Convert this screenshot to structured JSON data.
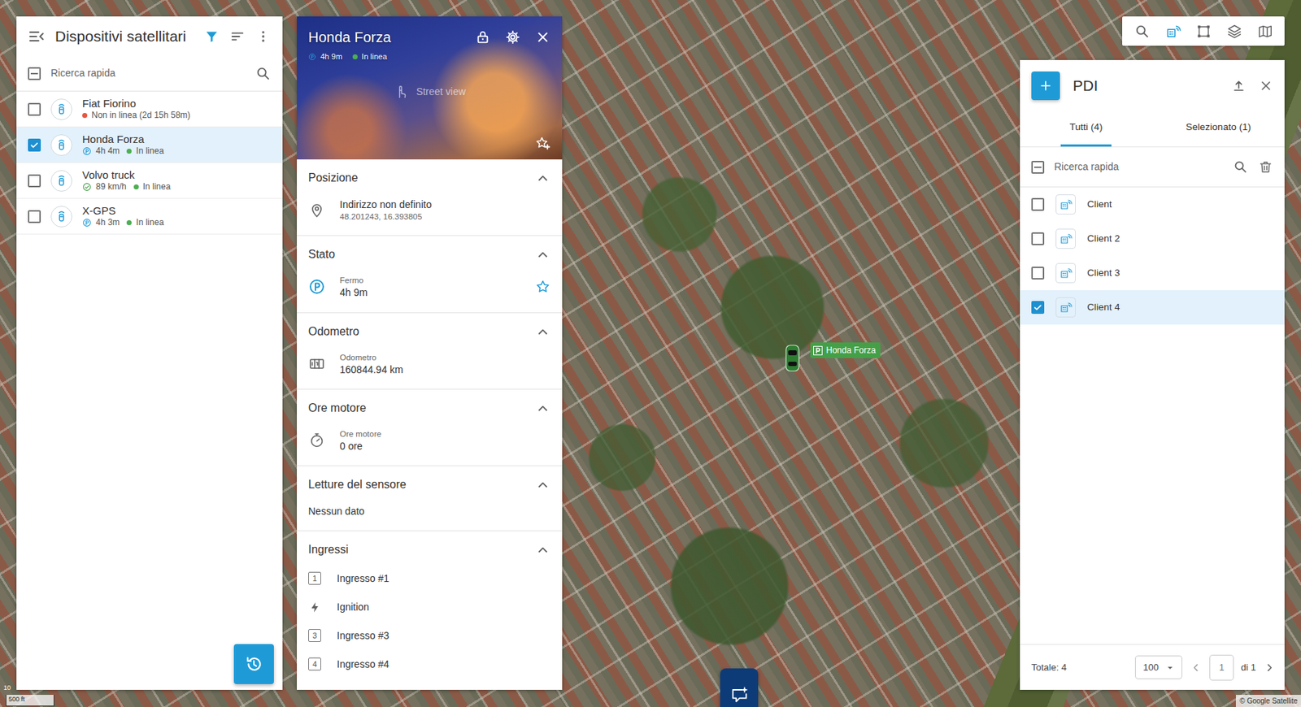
{
  "map": {
    "marker": {
      "label": "Honda Forza",
      "parked": true
    },
    "scale": {
      "metric": "10",
      "imperial": "500 ft"
    },
    "attribution": "© Google Satellite"
  },
  "toolbar": {
    "buttons": [
      {
        "selected": false
      },
      {
        "selected": true
      },
      {
        "selected": false
      },
      {
        "selected": false
      },
      {
        "selected": false
      }
    ]
  },
  "devices_panel": {
    "title": "Dispositivi satellitari",
    "search": {
      "placeholder": "Ricerca rapida"
    },
    "select_all": {
      "checked": false,
      "indeterminate": true
    },
    "items": [
      {
        "name": "Fiat Fiorino",
        "kind": "offline",
        "connection": "Non in linea (2d 15h 58m)",
        "color": "#e8553e",
        "checked": false,
        "selected": false
      },
      {
        "name": "Honda Forza",
        "kind": "parked",
        "motion": "4h 4m",
        "connection": "In linea",
        "color": "#4caf50",
        "checked": true,
        "selected": true
      },
      {
        "name": "Volvo truck",
        "kind": "moving",
        "motion": "89 km/h",
        "connection": "In linea",
        "color": "#4caf50",
        "checked": false,
        "selected": false
      },
      {
        "name": "X-GPS",
        "kind": "parked",
        "motion": "4h 3m",
        "connection": "In linea",
        "color": "#4caf50",
        "checked": false,
        "selected": false
      }
    ]
  },
  "detail_panel": {
    "title": "Honda Forza",
    "duration": "4h 9m",
    "connection": "In linea",
    "color": "#4caf50",
    "street_view": "Street view",
    "sections": [
      {
        "title": "Posizione",
        "expanded": true,
        "kind": "address",
        "primary": "Indirizzo non definito",
        "secondary": "48.201243, 16.393805"
      },
      {
        "title": "Stato",
        "expanded": true,
        "kind": "field",
        "label": "Fermo",
        "value": "4h 9m"
      },
      {
        "title": "Odometro",
        "expanded": true,
        "kind": "field",
        "label": "Odometro",
        "value": "160844.94 km"
      },
      {
        "title": "Ore motore",
        "expanded": true,
        "kind": "field",
        "label": "Ore motore",
        "value": "0 ore"
      },
      {
        "title": "Letture del sensore",
        "expanded": true,
        "kind": "text",
        "text": "Nessun dato"
      },
      {
        "title": "Ingressi",
        "expanded": true,
        "kind": "inputs",
        "items": [
          {
            "label": "Ingresso #1",
            "kind": "number",
            "badge": "1"
          },
          {
            "label": "Ignition",
            "kind": "ignition"
          },
          {
            "label": "Ingresso #3",
            "kind": "number",
            "badge": "3"
          },
          {
            "label": "Ingresso #4",
            "kind": "number",
            "badge": "4"
          }
        ]
      }
    ]
  },
  "poi_panel": {
    "title": "PDI",
    "tabs": [
      {
        "label": "Tutti (4)",
        "selected": true
      },
      {
        "label": "Selezionato (1)",
        "selected": false
      }
    ],
    "search": {
      "placeholder": "Ricerca rapida"
    },
    "select_all": {
      "checked": false,
      "indeterminate": true
    },
    "items": [
      {
        "name": "Client",
        "checked": false,
        "selected": false
      },
      {
        "name": "Client 2",
        "checked": false,
        "selected": false
      },
      {
        "name": "Client 3",
        "checked": false,
        "selected": false
      },
      {
        "name": "Client 4",
        "checked": true,
        "selected": true
      }
    ],
    "footer": {
      "total": "Totale: 4",
      "page_size": "100",
      "page": "1",
      "page_count": "di 1",
      "prev_disabled": true,
      "next_disabled": false
    }
  }
}
